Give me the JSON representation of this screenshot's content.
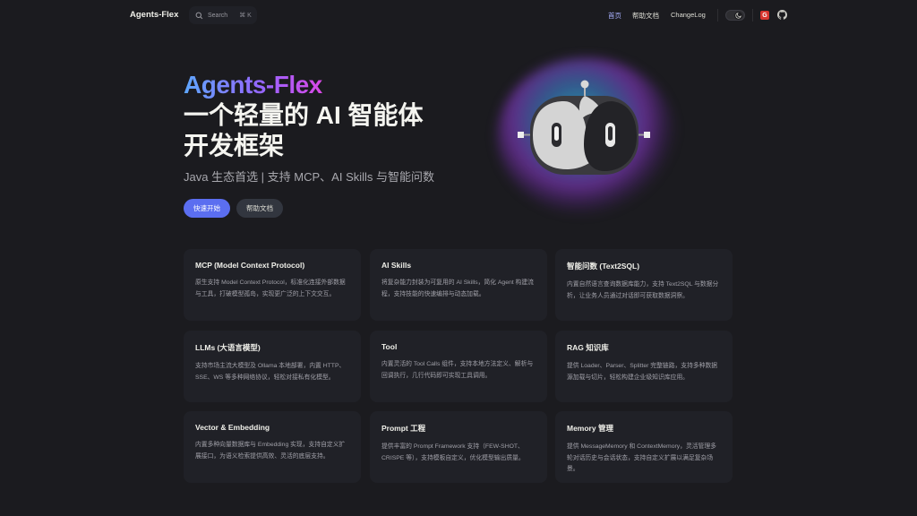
{
  "nav": {
    "brand": "Agents-Flex",
    "search_label": "Search",
    "search_shortcut": "⌘ K",
    "links": [
      "首页",
      "帮助文档",
      "ChangeLog"
    ],
    "social_g_letter": "G"
  },
  "hero": {
    "name": "Agents-Flex",
    "text_line1": "一个轻量的 AI 智能体",
    "text_line2": "开发框架",
    "tagline": "Java 生态首选 | 支持 MCP、AI Skills 与智能问数",
    "primary_button": "快速开始",
    "secondary_button": "帮助文档"
  },
  "features": [
    {
      "title": "MCP (Model Context Protocol)",
      "desc": "原生支持 Model Context Protocol，标准化连接外部数据与工具，打破模型孤岛，实现更广泛的上下文交互。"
    },
    {
      "title": "AI Skills",
      "desc": "将复杂能力封装为可复用的 AI Skills，简化 Agent 构建流程，支持技能的快速编排与动态加载。"
    },
    {
      "title": "智能问数 (Text2SQL)",
      "desc": "内置自然语言查询数据库能力，支持 Text2SQL 与数据分析，让业务人员通过对话即可获取数据洞察。"
    },
    {
      "title": "LLMs (大语言模型)",
      "desc": "支持市场主流大模型及 Ollama 本地部署，内置 HTTP、SSE、WS 等多种网络协议，轻松对接私有化模型。"
    },
    {
      "title": "Tool",
      "desc": "内置灵活的 Tool Calls 组件，支持本地方法定义、解析与回调执行，几行代码即可实现工具调用。"
    },
    {
      "title": "RAG 知识库",
      "desc": "提供 Loader、Parser、Splitter 完整链路，支持多种数据源加载与切片，轻松构建企业级知识库应用。"
    },
    {
      "title": "Vector & Embedding",
      "desc": "内置多种向量数据库与 Embedding 实现，支持自定义扩展接口，为语义检索提供高效、灵活的底层支持。"
    },
    {
      "title": "Prompt 工程",
      "desc": "提供丰富的 Prompt Framework 支持（FEW-SHOT、CRISPE 等），支持模板自定义，优化模型输出质量。"
    },
    {
      "title": "Memory 管理",
      "desc": "提供 MessageMemory 和 ContextMemory，灵活管理多轮对话历史与会话状态，支持自定义扩展以满足复杂场景。"
    }
  ],
  "colors": {
    "background": "#1b1b1f",
    "card": "#202127",
    "accent": "#5b6ef0",
    "nav_active": "#a8b1ff"
  }
}
